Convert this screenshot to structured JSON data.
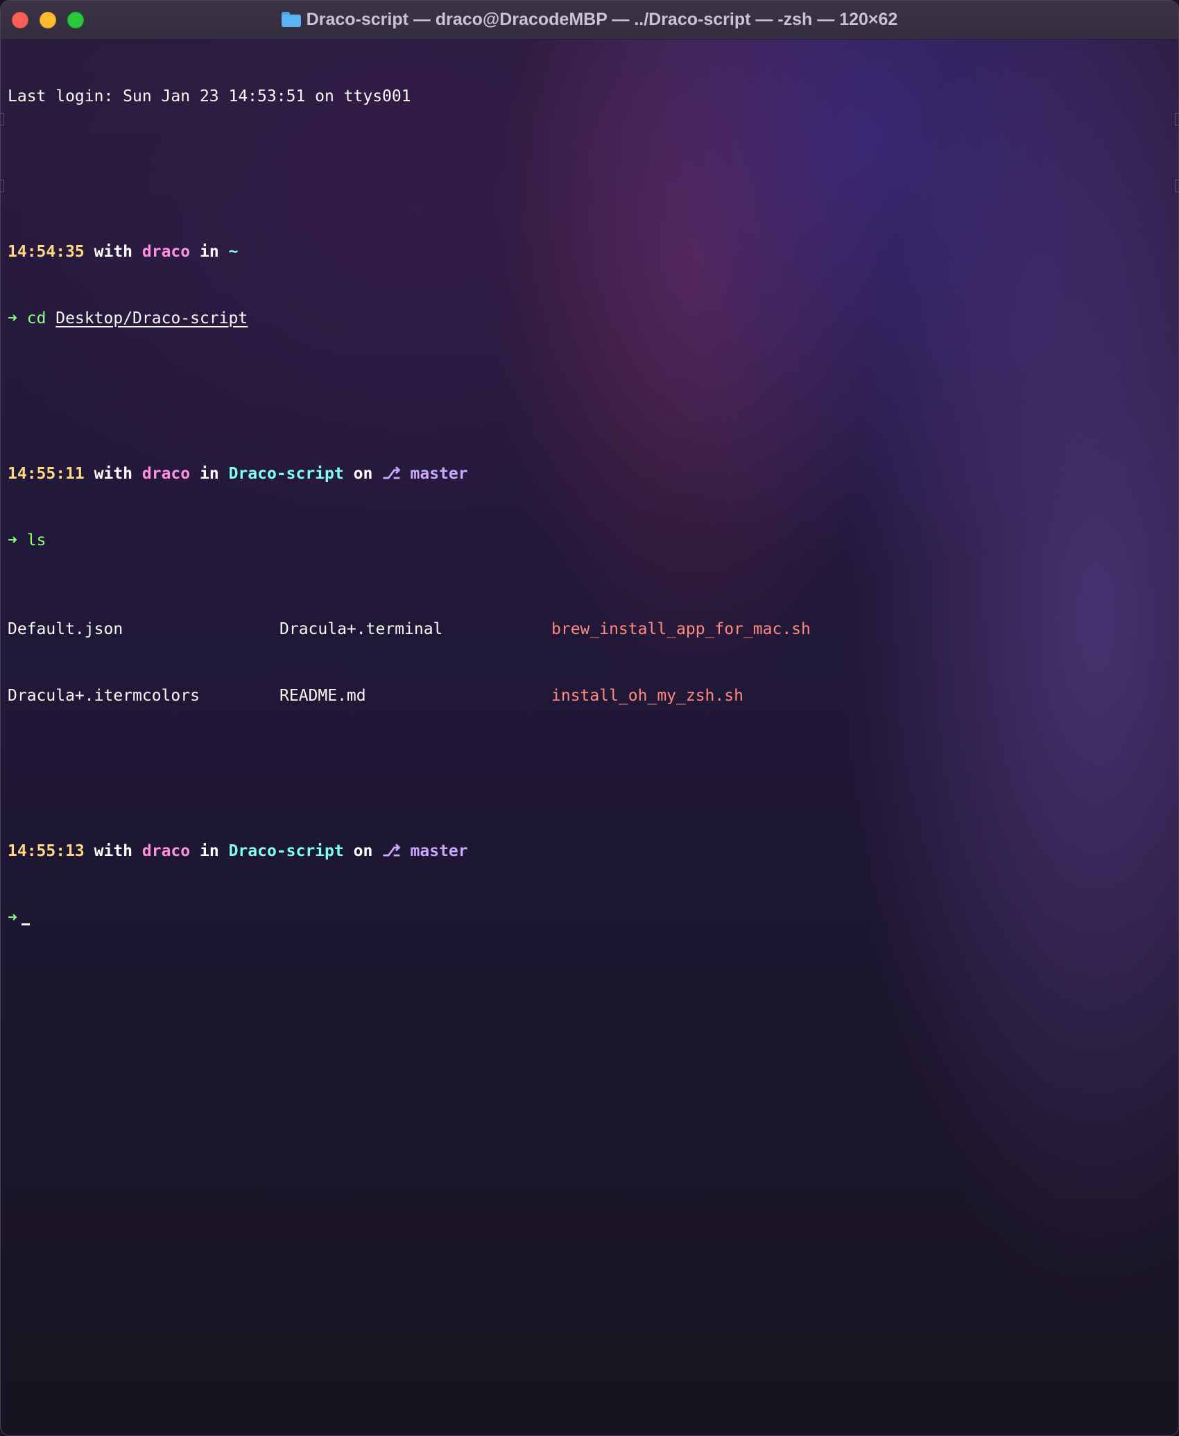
{
  "window": {
    "title": "Draco-script — draco@DracodeMBP — ../Draco-script — -zsh — 120×62",
    "icon": "folder-icon"
  },
  "terminal": {
    "last_login": "Last login: Sun Jan 23 14:53:51 on ttys001",
    "prompt1": {
      "time": "14:54:35",
      "with": "with",
      "user": "draco",
      "in": "in",
      "dir": "~",
      "arrow": "➜",
      "cmd": "cd",
      "arg": "Desktop/Draco-script"
    },
    "prompt2": {
      "time": "14:55:11",
      "with": "with",
      "user": "draco",
      "in": "in",
      "dir": "Draco-script",
      "on": "on",
      "branch_icon": "",
      "branch": "master",
      "arrow": "➜",
      "cmd": "ls"
    },
    "ls_output": [
      [
        "Default.json",
        "Dracula+.terminal",
        "brew_install_app_for_mac.sh"
      ],
      [
        "Dracula+.itermcolors",
        "README.md",
        "install_oh_my_zsh.sh"
      ]
    ],
    "prompt3": {
      "time": "14:55:13",
      "with": "with",
      "user": "draco",
      "in": "in",
      "dir": "Draco-script",
      "on": "on",
      "branch_icon": "",
      "branch": "master",
      "arrow": "➜"
    }
  },
  "colors": {
    "time": "#ffd880",
    "user": "#ff92df",
    "dir": "#80ffea",
    "branch": "#caa9fa",
    "arrow": "#8aff80",
    "executable": "#ff8a80"
  }
}
